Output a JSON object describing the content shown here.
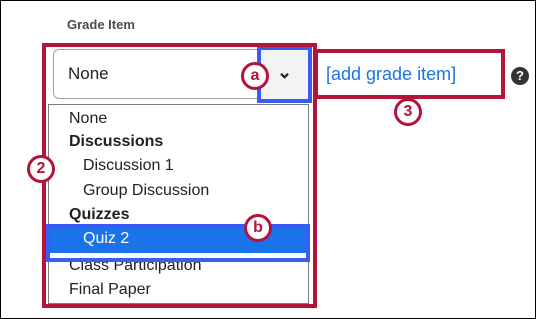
{
  "field": {
    "label": "Grade Item",
    "selected_value": "None"
  },
  "dropdown": {
    "items": [
      {
        "label": "None",
        "type": "option"
      },
      {
        "label": "Discussions",
        "type": "group"
      },
      {
        "label": "Discussion 1",
        "type": "sub"
      },
      {
        "label": "Group Discussion",
        "type": "sub"
      },
      {
        "label": "Quizzes",
        "type": "group"
      },
      {
        "label": "Quiz 2",
        "type": "sub",
        "highlighted": true
      },
      {
        "label": "Class Participation",
        "type": "option"
      },
      {
        "label": "Final Paper",
        "type": "option"
      }
    ]
  },
  "add_link": "[add grade item]",
  "annotations": {
    "a": "a",
    "b": "b",
    "two": "2",
    "three": "3"
  },
  "icons": {
    "chevron": "chevron-down-icon",
    "help": "question-circle-icon"
  },
  "colors": {
    "annotation": "#b5133a",
    "highlight": "#1a73e8",
    "focus": "#3b5bf7"
  }
}
